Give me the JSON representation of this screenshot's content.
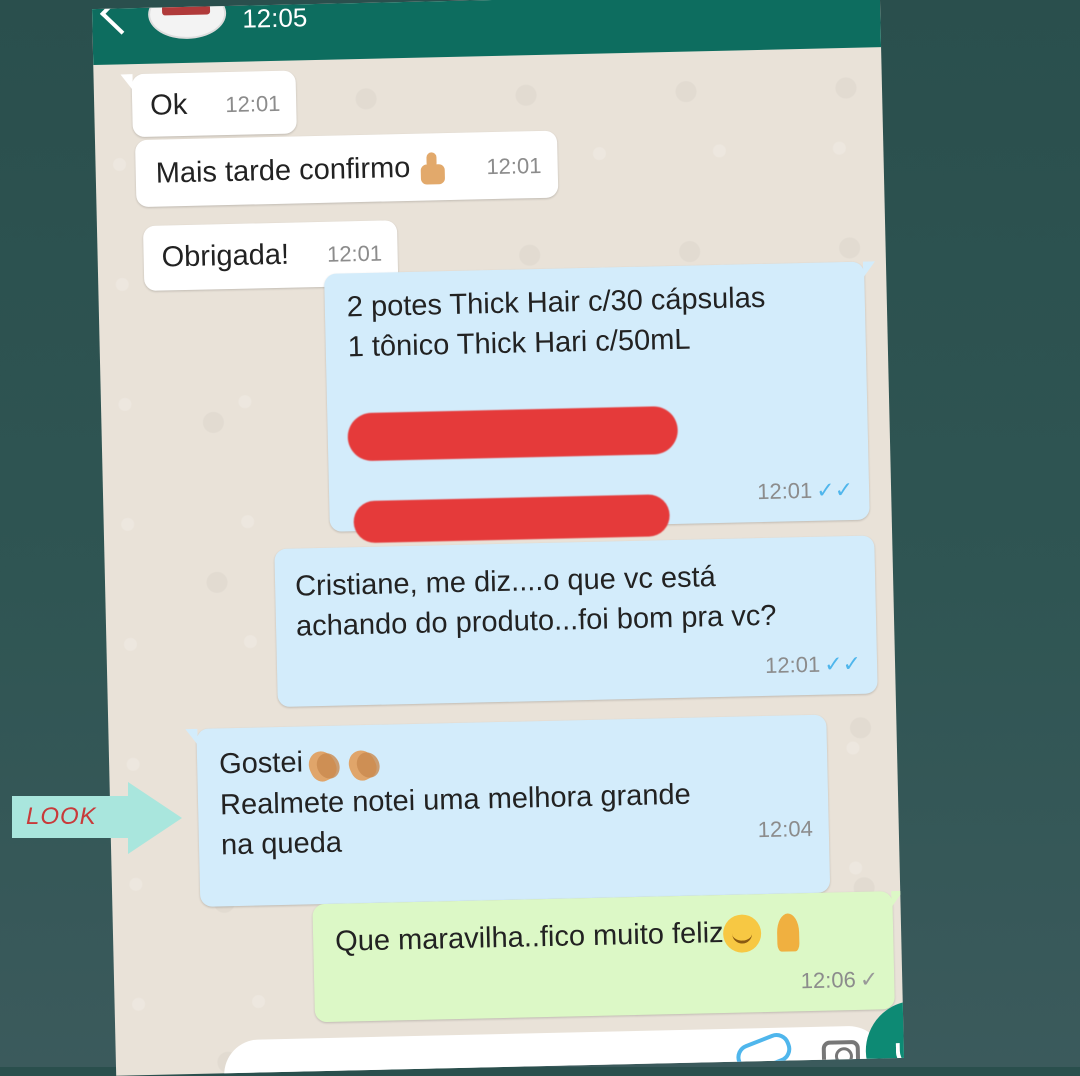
{
  "header": {
    "time": "12:05"
  },
  "messages": [
    {
      "id": "m1",
      "direction": "incoming",
      "text": "Ok",
      "time": "12:01"
    },
    {
      "id": "m2",
      "direction": "incoming",
      "text": "Mais tarde confirmo",
      "emoji": "thumbs-up",
      "time": "12:01"
    },
    {
      "id": "m3",
      "direction": "incoming",
      "text": "Obrigada!",
      "time": "12:01"
    },
    {
      "id": "m4",
      "direction": "outgoing",
      "lines": [
        "2 potes Thick Hair c/30 cápsulas",
        "1 tônico Thick Hari c/50mL"
      ],
      "redacted_lines": 2,
      "time": "12:01",
      "status": "read"
    },
    {
      "id": "m5",
      "direction": "outgoing",
      "lines": [
        "Cristiane, me diz....o que vc está",
        "achando do produto...foi bom pra vc?"
      ],
      "time": "12:01",
      "status": "read"
    },
    {
      "id": "m6",
      "direction": "incoming",
      "lines": [
        "Gostei",
        "Realmete notei uma melhora grande",
        "na queda"
      ],
      "emoji": [
        "clapping-hands",
        "clapping-hands"
      ],
      "time": "12:04"
    },
    {
      "id": "m7",
      "direction": "outgoing",
      "text": "Que maravilha..fico muito feliz",
      "emoji": [
        "smiling-face",
        "folded-hands"
      ],
      "time": "12:06",
      "status": "sent"
    }
  ],
  "sticker": {
    "text": "LOOK"
  },
  "colors": {
    "header": "#0d6d5f",
    "outgoing_blue": "#d3ecfb",
    "outgoing_green": "#dcf8c6",
    "incoming": "#ffffff",
    "redaction": "#e53a3a",
    "read_tick": "#4fb6ec"
  },
  "icons": {
    "back": "back-arrow-icon",
    "attach": "paperclip-icon",
    "camera": "camera-icon",
    "mic": "mic-icon"
  }
}
